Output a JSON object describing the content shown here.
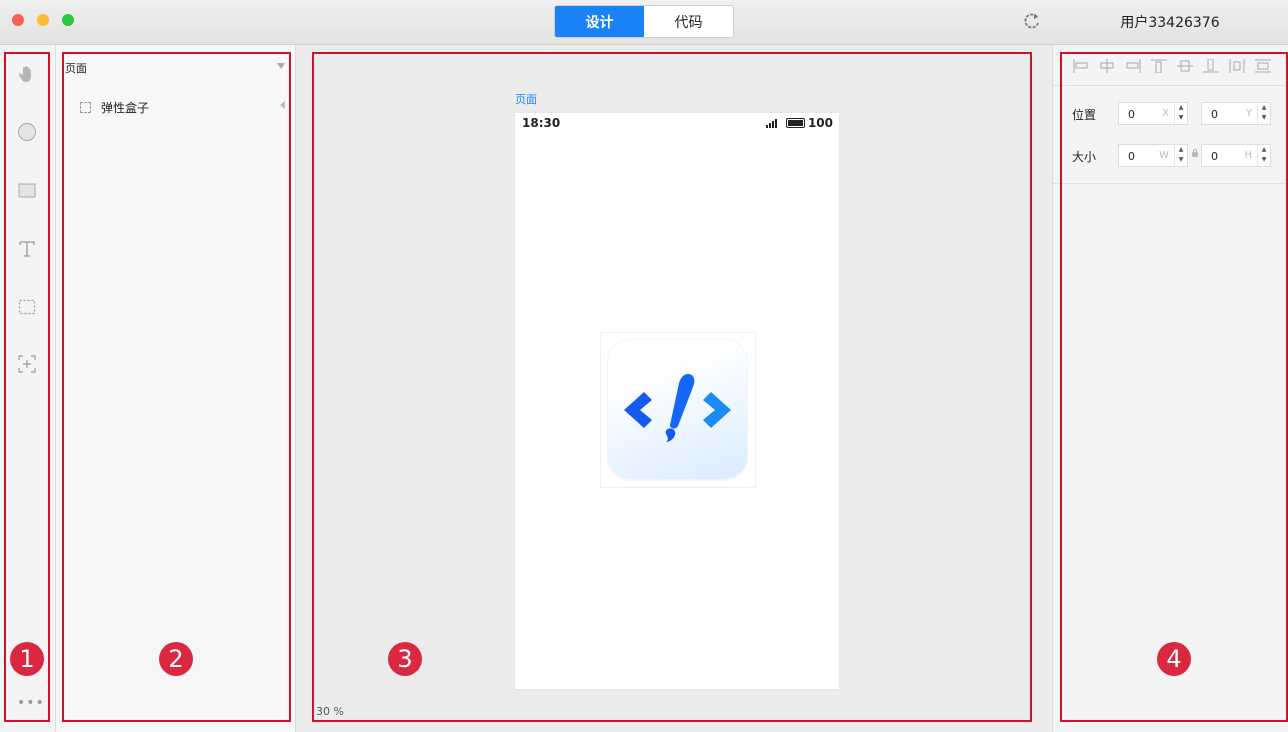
{
  "window": {
    "tabs": [
      {
        "label": "设计",
        "active": true
      },
      {
        "label": "代码",
        "active": false
      }
    ],
    "username": "用户33426376",
    "traffic_colors": [
      "#fc5f57",
      "#fdbc2e",
      "#28c840"
    ]
  },
  "toolbar": {
    "tools": [
      "hand-tool",
      "circle-tool",
      "rectangle-tool",
      "text-tool",
      "container-tool",
      "add-frame-tool"
    ],
    "more": "•••"
  },
  "layers": {
    "root": "页面",
    "children": [
      "弹性盒子"
    ]
  },
  "canvas": {
    "page_label": "页面",
    "phone": {
      "time": "18:30",
      "battery": "100"
    },
    "zoom": "30 %"
  },
  "inspector": {
    "position_label": "位置",
    "size_label": "大小",
    "x": {
      "value": "0",
      "unit": "X"
    },
    "y": {
      "value": "0",
      "unit": "Y"
    },
    "w": {
      "value": "0",
      "unit": "W"
    },
    "h": {
      "value": "0",
      "unit": "H"
    }
  },
  "annotations": [
    "1",
    "2",
    "3",
    "4"
  ],
  "colors": {
    "accent": "#1a82f7",
    "annotation": "#d0122d",
    "logo_blue": "#1667f5"
  }
}
